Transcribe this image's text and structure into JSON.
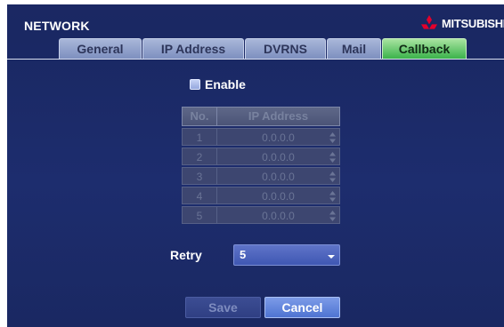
{
  "window": {
    "title": "NETWORK"
  },
  "brand": {
    "name": "MITSUBISHI",
    "color": "#e4002b"
  },
  "tabs": [
    {
      "label": "General",
      "active": false
    },
    {
      "label": "IP Address",
      "active": false
    },
    {
      "label": "DVRNS",
      "active": false
    },
    {
      "label": "Mail",
      "active": false
    },
    {
      "label": "Callback",
      "active": true
    }
  ],
  "enable": {
    "label": "Enable",
    "checked": false
  },
  "table": {
    "headers": [
      "No.",
      "IP Address"
    ],
    "rows": [
      {
        "no": "1",
        "ip": "0.0.0.0"
      },
      {
        "no": "2",
        "ip": "0.0.0.0"
      },
      {
        "no": "3",
        "ip": "0.0.0.0"
      },
      {
        "no": "4",
        "ip": "0.0.0.0"
      },
      {
        "no": "5",
        "ip": "0.0.0.0"
      }
    ]
  },
  "retry": {
    "label": "Retry",
    "value": "5"
  },
  "buttons": {
    "save": "Save",
    "cancel": "Cancel"
  },
  "colors": {
    "background": "#1b2863",
    "active_tab": "#3bb34a",
    "accent": "#4f74d2"
  }
}
